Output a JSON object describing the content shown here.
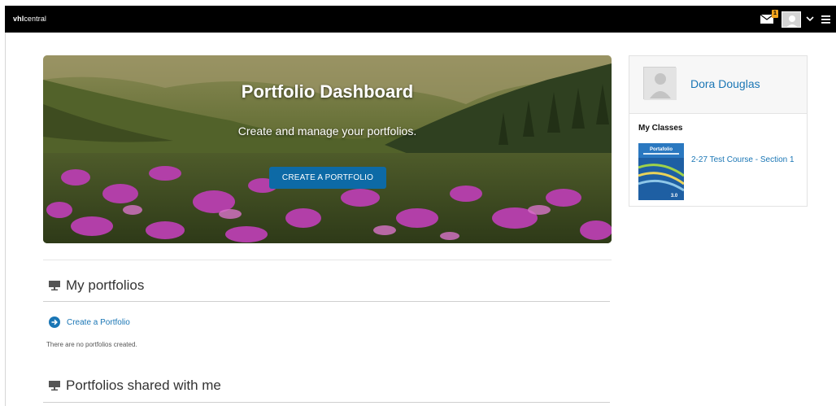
{
  "topbar": {
    "logo_bold": "vhl",
    "logo_rest": "central",
    "mail_count": "1",
    "icons": [
      "mail-icon",
      "user-avatar",
      "chevron-down-icon",
      "hamburger-menu-icon"
    ]
  },
  "hero": {
    "title": "Portfolio Dashboard",
    "subtitle": "Create and manage your portfolios.",
    "button_label": "CREATE A PORTFOLIO"
  },
  "profile": {
    "name": "Dora Douglas",
    "classes_heading": "My Classes",
    "classes": [
      {
        "label": "2-27 Test Course - Section 1",
        "thumb_title": "Portafolio",
        "thumb_version": "3.0"
      }
    ]
  },
  "sections": {
    "my_portfolios": {
      "title": "My portfolios",
      "create_link": "Create a Portfolio",
      "empty_text": "There are no portfolios created."
    },
    "shared": {
      "title": "Portfolios shared with me"
    }
  },
  "colors": {
    "topbar_bg": "#000000",
    "accent": "#1a76b5",
    "button": "#0d6aa6",
    "badge": "#f1a21b"
  }
}
